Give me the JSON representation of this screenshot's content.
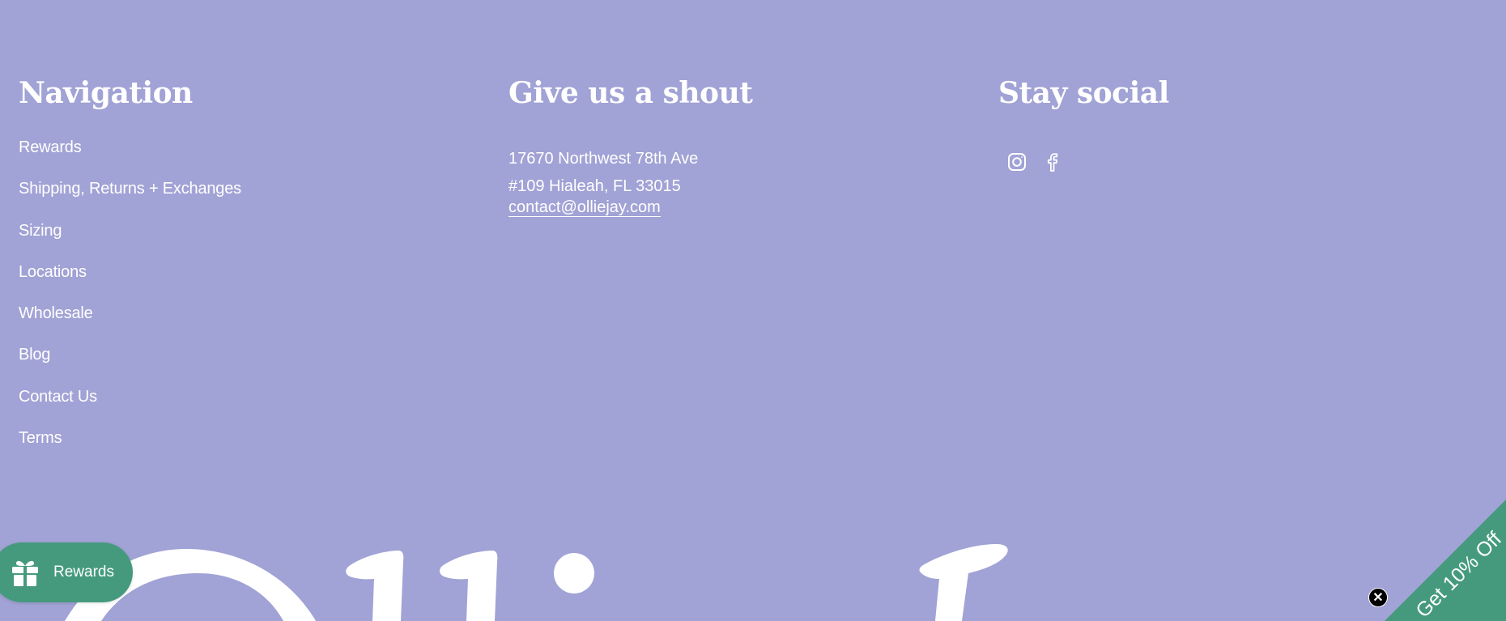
{
  "navigation": {
    "heading": "Navigation",
    "items": [
      {
        "label": "Rewards"
      },
      {
        "label": "Shipping, Returns + Exchanges"
      },
      {
        "label": "Sizing"
      },
      {
        "label": "Locations"
      },
      {
        "label": "Wholesale"
      },
      {
        "label": "Blog"
      },
      {
        "label": "Contact Us"
      },
      {
        "label": "Terms"
      }
    ]
  },
  "contact": {
    "heading": "Give us a shout",
    "address_line1": "17670 Northwest 78th Ave",
    "address_line2": "#109 Hialeah, FL 33015",
    "email": "contact@olliejay.com"
  },
  "social": {
    "heading": "Stay social",
    "icons": [
      "instagram-icon",
      "facebook-icon"
    ]
  },
  "rewards_launcher": {
    "label": "Rewards",
    "icon": "gift-icon",
    "color": "#459a7d"
  },
  "discount_tab": {
    "label": "Get 10% Off",
    "color": "#459a7d"
  },
  "close_button": {
    "glyph": "✕"
  },
  "colors": {
    "background": "#a1a2d5",
    "text": "#ffffff",
    "accent": "#459a7d"
  }
}
